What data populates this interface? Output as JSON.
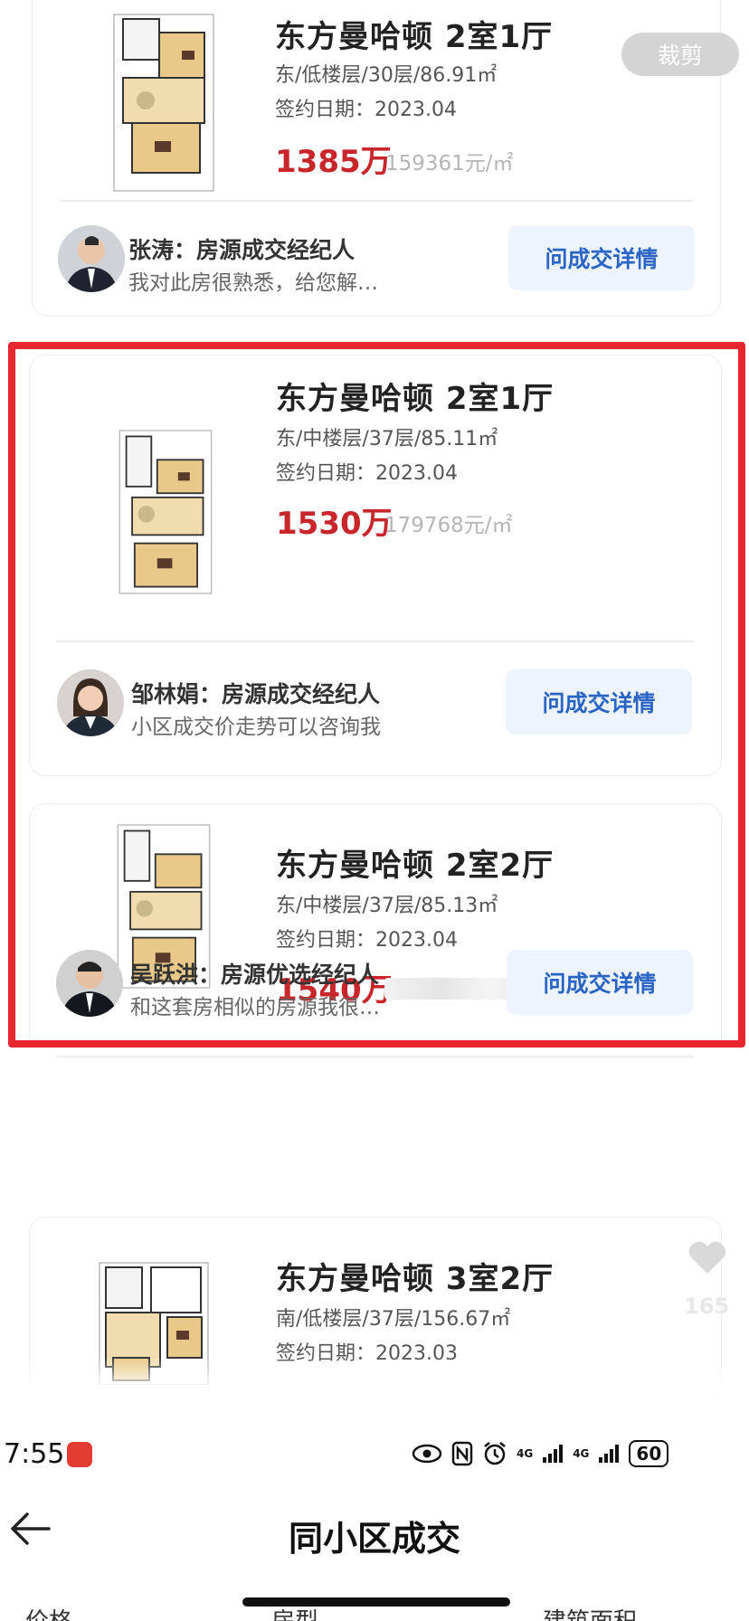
{
  "crop_button": "裁剪",
  "listings": [
    {
      "title": "东方曼哈顿 2室1厅",
      "meta": "东/低楼层/30层/86.91㎡",
      "date": "签约日期：2023.04",
      "price": "1385万",
      "unit_price": "159361元/㎡",
      "agent_name": "张涛：房源成交经纪人",
      "agent_msg": "我对此房很熟悉，给您解…",
      "button": "问成交详情"
    },
    {
      "title": "东方曼哈顿 2室1厅",
      "meta": "东/中楼层/37层/85.11㎡",
      "date": "签约日期：2023.04",
      "price": "1530万",
      "unit_price": "179768元/㎡",
      "agent_name": "邹林娟：房源成交经纪人",
      "agent_msg": "小区成交价走势可以咨询我",
      "button": "问成交详情"
    },
    {
      "title": "东方曼哈顿 2室2厅",
      "meta": "东/中楼层/37层/85.13㎡",
      "date": "签约日期：2023.04",
      "price": "1540万",
      "agent_name": "吴跃洪：房源优选经纪人",
      "agent_msg": "和这套房相似的房源我很…",
      "button": "问成交详情"
    },
    {
      "title": "东方曼哈顿 3室2厅",
      "meta": "南/低楼层/37层/156.67㎡",
      "date": "签约日期：2023.03"
    }
  ],
  "like_count": "165",
  "status_bar": {
    "time": "7:55",
    "battery": "60",
    "signal_1": "4G",
    "signal_2": "4G"
  },
  "nav": {
    "title": "同小区成交"
  },
  "filters": [
    "价格",
    "房型",
    "建筑面积"
  ],
  "colors": {
    "price_red": "#c9262c",
    "highlight_border": "#e8262d",
    "button_text": "#2a64c4",
    "button_bg": "#eef4fd"
  }
}
